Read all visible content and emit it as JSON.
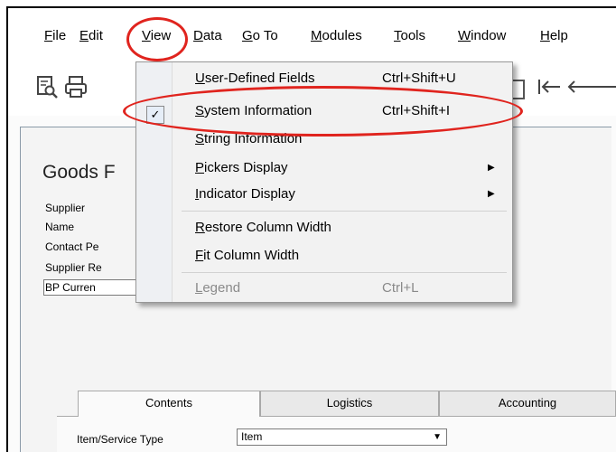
{
  "menubar": {
    "items": [
      {
        "label": "File",
        "ul": "F",
        "rest": "ile"
      },
      {
        "label": "Edit",
        "ul": "E",
        "rest": "dit"
      },
      {
        "label": "View",
        "ul": "V",
        "rest": "iew"
      },
      {
        "label": "Data",
        "ul": "D",
        "rest": "ata"
      },
      {
        "label": "Go To",
        "ul": "G",
        "rest": "o To"
      },
      {
        "label": "Modules",
        "ul": "M",
        "rest": "odules"
      },
      {
        "label": "Tools",
        "ul": "T",
        "rest": "ools"
      },
      {
        "label": "Window",
        "ul": "W",
        "rest": "indow"
      },
      {
        "label": "Help",
        "ul": "H",
        "rest": "elp"
      }
    ]
  },
  "toolbar": {
    "icons": [
      "preview-icon",
      "print-icon",
      "first-record-icon",
      "previous-record-icon"
    ],
    "first_glyph": "I←",
    "prev_glyph": "←"
  },
  "document": {
    "title": "Goods F",
    "fields": [
      "Supplier",
      "Name",
      "Contact Pe",
      "Supplier Re",
      "BP Curren"
    ]
  },
  "tabs": [
    "Contents",
    "Logistics",
    "Accounting"
  ],
  "contents": {
    "item_service_type_label": "Item/Service Type",
    "item_service_type_value": "Item"
  },
  "view_menu": {
    "items": [
      {
        "ul": "U",
        "rest": "ser-Defined Fields",
        "shortcut": "Ctrl+Shift+U"
      },
      {
        "ul": "S",
        "rest": "ystem Information",
        "shortcut": "Ctrl+Shift+I",
        "checked": true
      },
      {
        "ul": "S",
        "rest": "tring Information",
        "shortcut": ""
      },
      {
        "ul": "P",
        "rest": "ickers Display",
        "shortcut": "",
        "submenu": true
      },
      {
        "ul": "I",
        "rest": "ndicator Display",
        "shortcut": "",
        "submenu": true
      },
      {
        "ul": "R",
        "rest": "estore Column Width",
        "shortcut": ""
      },
      {
        "ul": "F",
        "rest": "it Column Width",
        "shortcut": ""
      },
      {
        "ul": "L",
        "rest": "egend",
        "shortcut": "Ctrl+L",
        "disabled": true
      }
    ],
    "check_glyph": "✓",
    "submenu_glyph": "▶"
  },
  "colors": {
    "annotation_red": "#e0241e",
    "menu_bg": "#f2f2f2"
  }
}
